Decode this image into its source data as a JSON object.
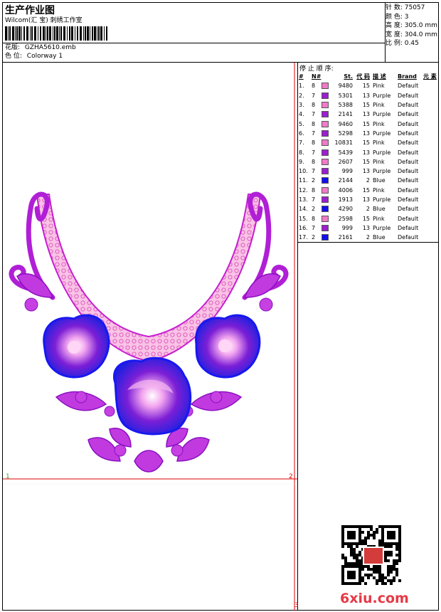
{
  "header": {
    "title": "生产作业图",
    "company": "Wilcom(汇 宝) 刺绣工作室",
    "design_label": "花版:",
    "design_value": "GZHA5610.emb",
    "colorway_label": "色 位:",
    "colorway_value": "Colorway 1"
  },
  "stats": {
    "stitches": "针 数: 75057",
    "colors": "颜 色: 3",
    "height": "高 度: 305.0 mm",
    "width": "宽 度: 304.0 mm",
    "scale": "比 例: 0.45"
  },
  "stop_sequence": {
    "title": "停 止 顺 序:",
    "headers": [
      "#",
      "N#",
      "St.",
      "代 码",
      "描 述",
      "Brand",
      "元 素"
    ],
    "rows": [
      {
        "n": "1.",
        "needle": "8",
        "st": "9480",
        "code": "15",
        "desc": "Pink",
        "brand": "Default",
        "color": "#f07ac8"
      },
      {
        "n": "2.",
        "needle": "7",
        "st": "5301",
        "code": "13",
        "desc": "Purple",
        "brand": "Default",
        "color": "#9b1fd1"
      },
      {
        "n": "3.",
        "needle": "8",
        "st": "5388",
        "code": "15",
        "desc": "Pink",
        "brand": "Default",
        "color": "#f07ac8"
      },
      {
        "n": "4.",
        "needle": "7",
        "st": "2141",
        "code": "13",
        "desc": "Purple",
        "brand": "Default",
        "color": "#9b1fd1"
      },
      {
        "n": "5.",
        "needle": "8",
        "st": "9460",
        "code": "15",
        "desc": "Pink",
        "brand": "Default",
        "color": "#f07ac8"
      },
      {
        "n": "6.",
        "needle": "7",
        "st": "5298",
        "code": "13",
        "desc": "Purple",
        "brand": "Default",
        "color": "#9b1fd1"
      },
      {
        "n": "7.",
        "needle": "8",
        "st": "10831",
        "code": "15",
        "desc": "Pink",
        "brand": "Default",
        "color": "#f07ac8"
      },
      {
        "n": "8.",
        "needle": "7",
        "st": "5439",
        "code": "13",
        "desc": "Purple",
        "brand": "Default",
        "color": "#9b1fd1"
      },
      {
        "n": "9.",
        "needle": "8",
        "st": "2607",
        "code": "15",
        "desc": "Pink",
        "brand": "Default",
        "color": "#f07ac8"
      },
      {
        "n": "10.",
        "needle": "7",
        "st": "999",
        "code": "13",
        "desc": "Purple",
        "brand": "Default",
        "color": "#9b1fd1"
      },
      {
        "n": "11.",
        "needle": "2",
        "st": "2144",
        "code": "2",
        "desc": "Blue",
        "brand": "Default",
        "color": "#1010ee"
      },
      {
        "n": "12.",
        "needle": "8",
        "st": "4006",
        "code": "15",
        "desc": "Pink",
        "brand": "Default",
        "color": "#f07ac8"
      },
      {
        "n": "13.",
        "needle": "7",
        "st": "1913",
        "code": "13",
        "desc": "Purple",
        "brand": "Default",
        "color": "#9b1fd1"
      },
      {
        "n": "14.",
        "needle": "2",
        "st": "4290",
        "code": "2",
        "desc": "Blue",
        "brand": "Default",
        "color": "#1010ee"
      },
      {
        "n": "15.",
        "needle": "8",
        "st": "2598",
        "code": "15",
        "desc": "Pink",
        "brand": "Default",
        "color": "#f07ac8"
      },
      {
        "n": "16.",
        "needle": "7",
        "st": "999",
        "code": "13",
        "desc": "Purple",
        "brand": "Default",
        "color": "#9b1fd1"
      },
      {
        "n": "17.",
        "needle": "2",
        "st": "2161",
        "code": "2",
        "desc": "Blue",
        "brand": "Default",
        "color": "#1010ee"
      }
    ]
  },
  "canvas": {
    "marker_1": "1",
    "marker_2": "2",
    "marker_3": "3"
  },
  "watermark": "6xiu.com",
  "colors": {
    "pink": "#f07ac8",
    "purple": "#9b1fd1",
    "blue": "#1010ee",
    "guide": "#e00000"
  }
}
